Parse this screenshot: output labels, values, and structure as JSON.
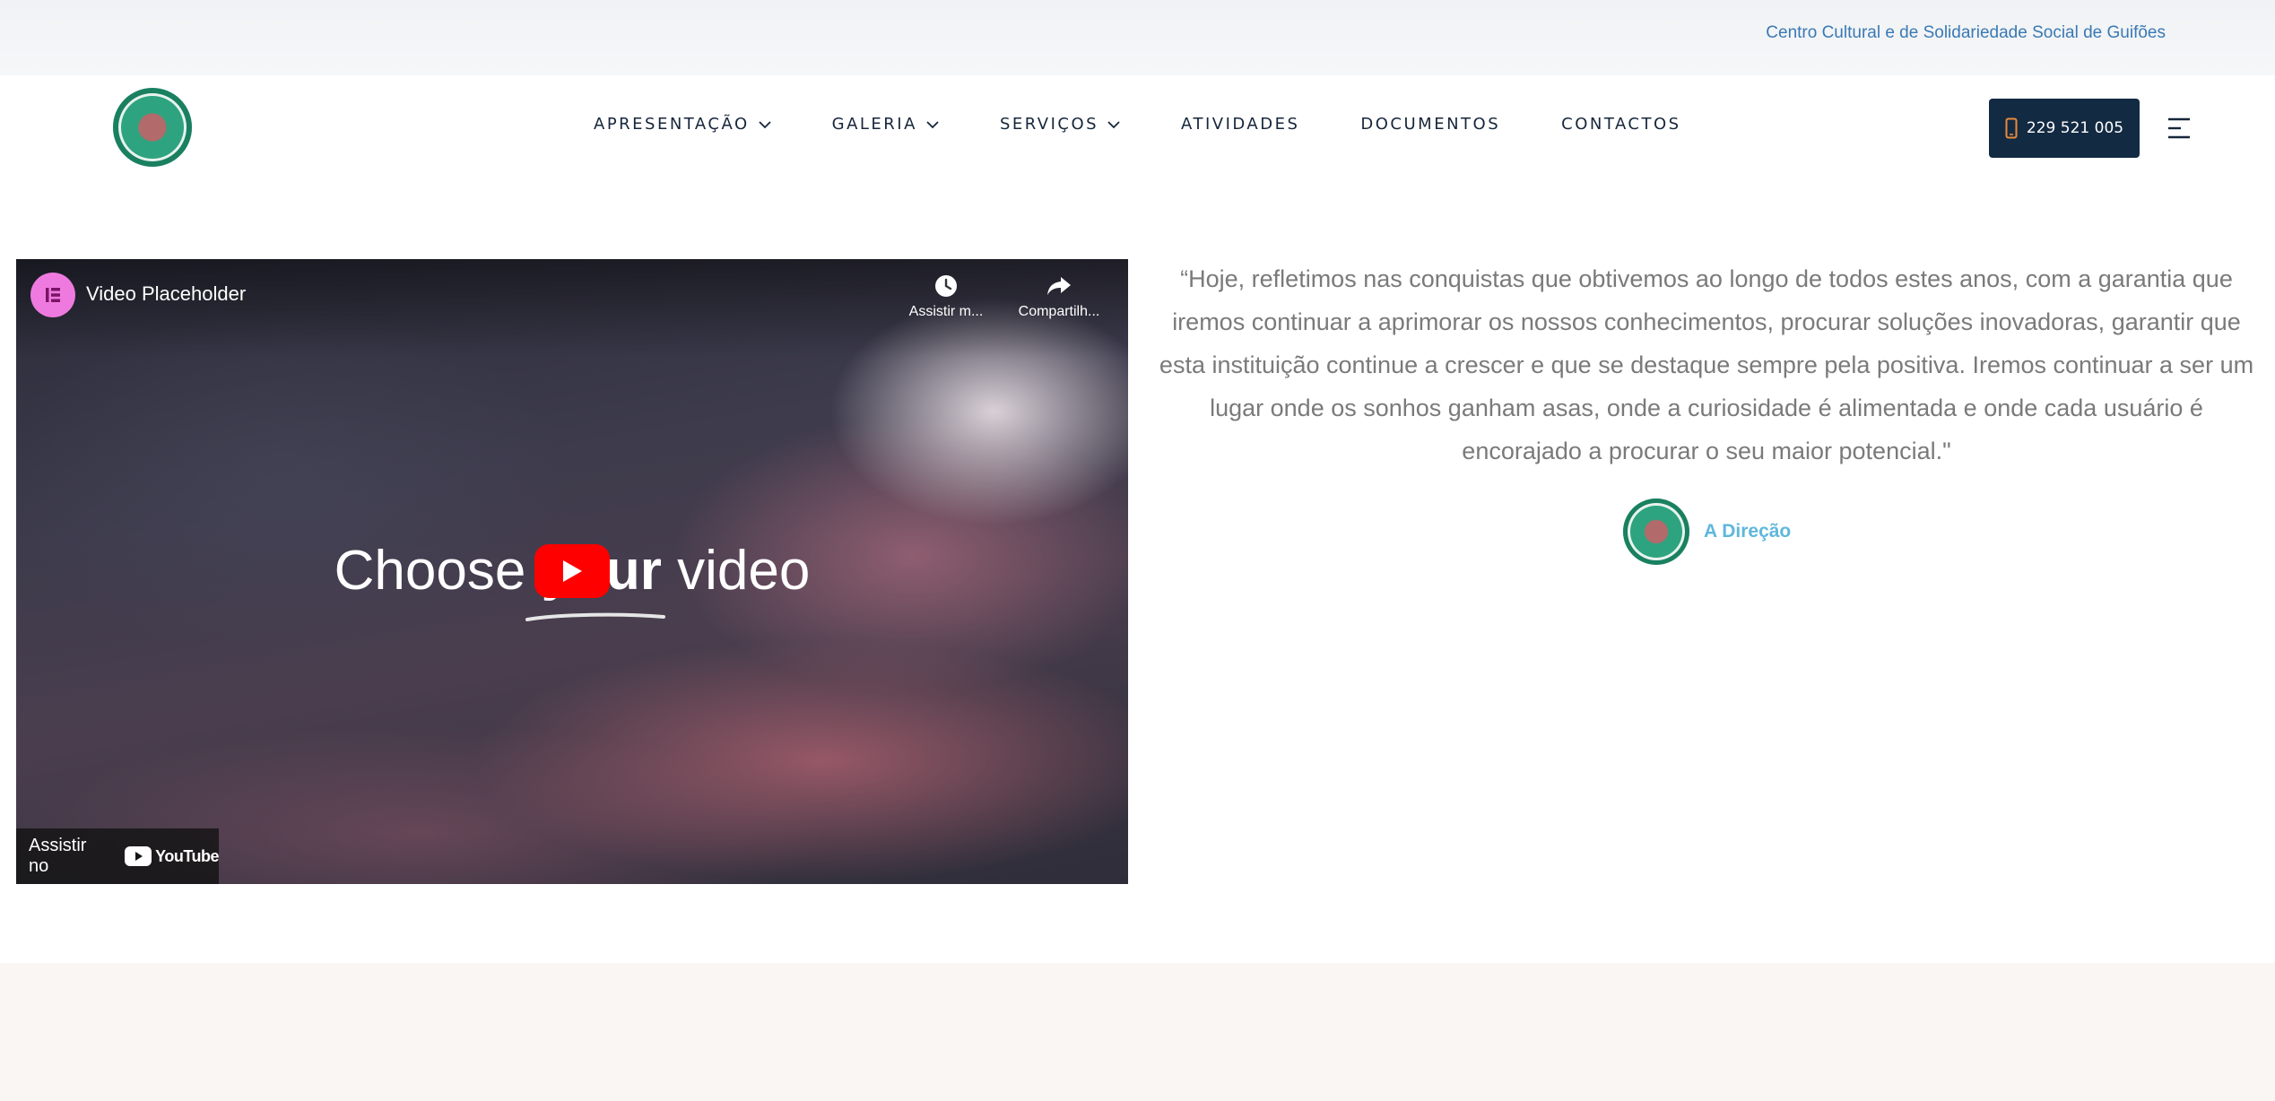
{
  "topbar": {
    "org_name": "Centro Cultural e de Solidariedade Social de Guifões"
  },
  "header": {
    "logo_icon": "institution-logo",
    "nav": [
      {
        "label": "APRESENTAÇÃO",
        "has_dropdown": true
      },
      {
        "label": "GALERIA",
        "has_dropdown": true
      },
      {
        "label": "SERVIÇOS",
        "has_dropdown": true
      },
      {
        "label": "ATIVIDADES",
        "has_dropdown": false
      },
      {
        "label": "DOCUMENTOS",
        "has_dropdown": false
      },
      {
        "label": "CONTACTOS",
        "has_dropdown": false
      }
    ],
    "phone": "229 521 005",
    "phone_icon": "mobile-phone-icon",
    "menu_icon": "hamburger-menu-icon",
    "colors": {
      "button_bg": "#132a43",
      "phone_icon": "#e98a3a"
    }
  },
  "video": {
    "title": "Video Placeholder",
    "watch_later_label": "Assistir m...",
    "share_label": "Compartilh...",
    "center_text_prefix": "Choose ",
    "center_text_bold": "your",
    "center_text_suffix": " video",
    "watch_on_label": "Assistir no",
    "youtube_label": "YouTube",
    "colors": {
      "play_button": "#ff0000",
      "elementor_logo": "#ef7adf"
    }
  },
  "testimonial": {
    "quote": "“Hoje, refletimos nas conquistas que obtivemos ao longo de todos estes anos, com a garantia que iremos continuar a aprimorar os nossos conhecimentos, procurar soluções inovadoras, garantir que esta instituição continue a crescer e que se destaque sempre pela positiva. Iremos continuar a ser um lugar onde os sonhos ganham asas, onde a curiosidade é alimentada e onde cada usuário é encorajado a procurar o seu maior potencial.\"",
    "author": "A Direção",
    "colors": {
      "quote_text": "#7a7a7a",
      "author_text": "#5fb7dc"
    }
  }
}
